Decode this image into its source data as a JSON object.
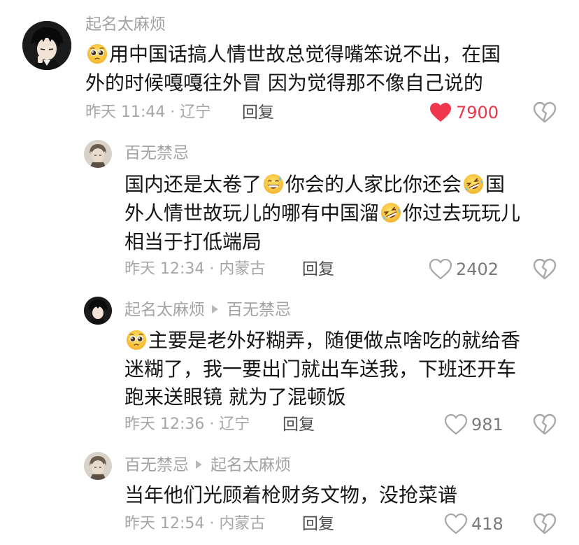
{
  "comments": [
    {
      "username": "起名太麻烦",
      "text_line1": "用中国话搞人情世故总觉得嘴笨说不出，在国",
      "text_line2": "外的时候嘎嘎往外冒  因为觉得那不像自己说的",
      "time": "昨天 11:44 · 辽宁",
      "reply": "回复",
      "likes": "7900",
      "liked": true
    },
    {
      "username": "百无禁忌",
      "text_line1_a": "国内还是太卷了",
      "text_line1_b": "你会的人家比你还会",
      "text_line1_c": "国",
      "text_line2_a": "外人情世故玩儿的哪有中国溜",
      "text_line2_b": "你过去玩玩儿",
      "text_line3": "相当于打低端局",
      "time": "昨天 12:34 · 内蒙古",
      "reply": "回复",
      "likes": "2402",
      "liked": false
    },
    {
      "username": "起名太麻烦",
      "reply_to": "百无禁忌",
      "text_line1": "主要是老外好糊弄，随便做点啥吃的就给香",
      "text_line2": "迷糊了，我一要出门就出车送我，下班还开车",
      "text_line3": "跑来送眼镜 就为了混顿饭",
      "time": "昨天 12:36 · 辽宁",
      "reply": "回复",
      "likes": "981",
      "liked": false
    },
    {
      "username": "百无禁忌",
      "reply_to": "起名太麻烦",
      "text_line1": "当年他们光顾着枪财务文物，没抢菜谱",
      "time": "昨天 12:54 · 内蒙古",
      "reply": "回复",
      "likes": "418",
      "liked": false
    }
  ],
  "colors": {
    "liked_heart": "#f0364c",
    "meta_gray": "#a6a6a6",
    "text": "#151515"
  },
  "icons": [
    "pleading-face-emoji",
    "grinning-sweat-emoji",
    "rofl-emoji",
    "heart-icon",
    "broken-heart-icon",
    "reply-arrow-icon"
  ]
}
